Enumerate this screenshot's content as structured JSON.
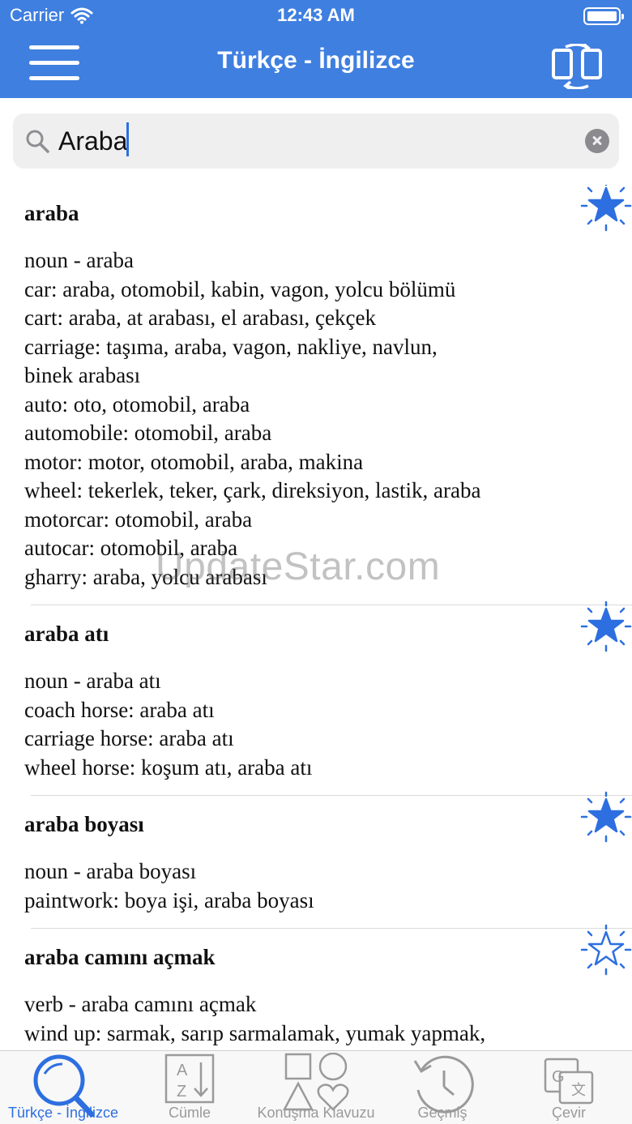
{
  "status_bar": {
    "carrier": "Carrier",
    "time": "12:43 AM"
  },
  "nav": {
    "title": "Türkçe - İngilizce"
  },
  "search": {
    "value": "Araba",
    "placeholder": ""
  },
  "entries": [
    {
      "headword": "araba",
      "starred": true,
      "lines": [
        "noun - araba",
        "car: araba, otomobil, kabin, vagon, yolcu bölümü",
        "cart: araba, at arabası, el arabası, çekçek",
        "carriage: taşıma, araba, vagon, nakliye, navlun,",
        "binek arabası",
        "auto: oto, otomobil, araba",
        "automobile: otomobil, araba",
        "motor: motor, otomobil, araba, makina",
        "wheel: tekerlek, teker, çark, direksiyon, lastik, araba",
        "motorcar: otomobil, araba",
        "autocar: otomobil, araba",
        "gharry: araba, yolcu arabası"
      ]
    },
    {
      "headword": "araba atı",
      "starred": true,
      "lines": [
        "noun - araba atı",
        "coach horse: araba atı",
        "carriage horse: araba atı",
        "wheel horse: koşum atı, araba atı"
      ]
    },
    {
      "headword": "araba boyası",
      "starred": true,
      "lines": [
        "noun - araba boyası",
        "paintwork: boya işi, araba boyası"
      ]
    },
    {
      "headword": "araba camını açmak",
      "starred": false,
      "lines": [
        "verb - araba camını açmak",
        "wind up: sarmak, sarıp sarmalamak, yumak yapmak,"
      ]
    }
  ],
  "watermark": "UpdateStar.com",
  "tabs": [
    {
      "label": "Türkçe - İngilizce",
      "icon": "search-icon",
      "active": true
    },
    {
      "label": "Cümle",
      "icon": "sort-az-icon",
      "active": false
    },
    {
      "label": "Konuşma Klavuzu",
      "icon": "shapes-icon",
      "active": false
    },
    {
      "label": "Geçmiş",
      "icon": "history-icon",
      "active": false
    },
    {
      "label": "Çevir",
      "icon": "translate-icon",
      "active": false
    }
  ],
  "colors": {
    "accent": "#3f7fe0",
    "star": "#2d6fe0"
  }
}
